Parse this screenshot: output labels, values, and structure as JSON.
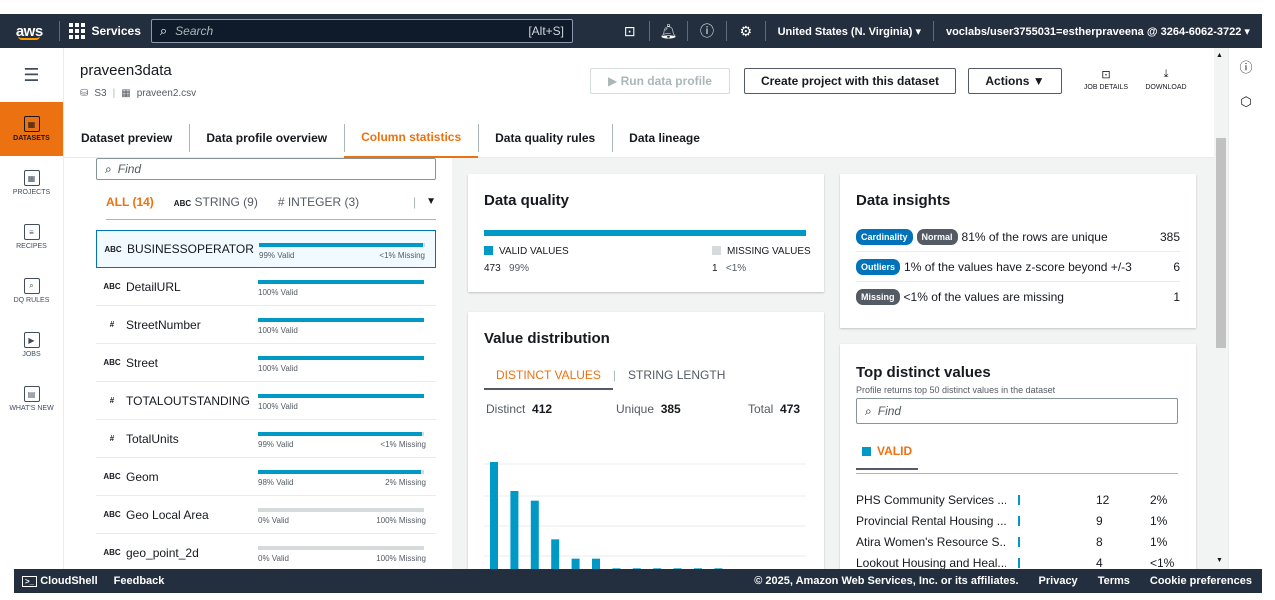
{
  "topbar": {
    "logo": "aws",
    "services": "Services",
    "search_placeholder": "Search",
    "search_shortcut": "[Alt+S]",
    "region": "United States (N. Virginia) ▾",
    "account": "voclabs/user3755031=estherpraveena @ 3264-6062-3722 ▾"
  },
  "leftnav": {
    "items": [
      {
        "label": "DATASETS",
        "icon": "grid-icon"
      },
      {
        "label": "PROJECTS",
        "icon": "projects-icon"
      },
      {
        "label": "RECIPES",
        "icon": "recipes-icon"
      },
      {
        "label": "DQ RULES",
        "icon": "dq-rules-icon"
      },
      {
        "label": "JOBS",
        "icon": "jobs-icon"
      },
      {
        "label": "WHAT'S NEW",
        "icon": "whats-new-icon"
      }
    ]
  },
  "header": {
    "dataset_name": "praveen3data",
    "source": "S3",
    "file": "praveen2.csv",
    "run_profile": "▶  Run data profile",
    "create_project": "Create project with this dataset",
    "actions": "Actions  ▼",
    "job_details": "JOB DETAILS",
    "download": "DOWNLOAD"
  },
  "tabs": [
    "Dataset preview",
    "Data profile overview",
    "Column statistics",
    "Data quality rules",
    "Data lineage"
  ],
  "columns_panel": {
    "find_placeholder": "Find",
    "filters": [
      "ALL (14)",
      "STRING (9)",
      "# INTEGER (3)"
    ],
    "filter_type_badge": "ABC",
    "columns": [
      {
        "type": "ABC",
        "name": "BUSINESSOPERATOR",
        "valid_pct": 99,
        "valid": "99% Valid",
        "missing": "<1% Missing"
      },
      {
        "type": "ABC",
        "name": "DetailURL",
        "valid_pct": 100,
        "valid": "100% Valid",
        "missing": ""
      },
      {
        "type": "#",
        "name": "StreetNumber",
        "valid_pct": 100,
        "valid": "100% Valid",
        "missing": ""
      },
      {
        "type": "ABC",
        "name": "Street",
        "valid_pct": 100,
        "valid": "100% Valid",
        "missing": ""
      },
      {
        "type": "#",
        "name": "TOTALOUTSTANDING",
        "valid_pct": 100,
        "valid": "100% Valid",
        "missing": ""
      },
      {
        "type": "#",
        "name": "TotalUnits",
        "valid_pct": 99,
        "valid": "99% Valid",
        "missing": "<1% Missing"
      },
      {
        "type": "ABC",
        "name": "Geom",
        "valid_pct": 98,
        "valid": "98% Valid",
        "missing": "2% Missing"
      },
      {
        "type": "ABC",
        "name": "Geo Local Area",
        "valid_pct": 0,
        "valid": "0% Valid",
        "missing": "100% Missing"
      },
      {
        "type": "ABC",
        "name": "geo_point_2d",
        "valid_pct": 0,
        "valid": "0% Valid",
        "missing": "100% Missing"
      }
    ]
  },
  "data_quality": {
    "title": "Data quality",
    "valid_label": "VALID VALUES",
    "valid_count": "473",
    "valid_pct": "99%",
    "missing_label": "MISSING VALUES",
    "missing_count": "1",
    "missing_pct": "<1%",
    "colors": {
      "valid": "#0099c6",
      "missing": "#d5dbdb"
    }
  },
  "value_distribution": {
    "title": "Value distribution",
    "tab_distinct": "DISTINCT VALUES",
    "tab_length": "STRING LENGTH",
    "distinct_label": "Distinct",
    "distinct": "412",
    "unique_label": "Unique",
    "unique": "385",
    "total_label": "Total",
    "total": "473",
    "bars": [
      12,
      9,
      8,
      4,
      2,
      2,
      1,
      1,
      1,
      1,
      1,
      1
    ]
  },
  "insights": {
    "title": "Data insights",
    "rows": [
      {
        "badges": [
          "Cardinality",
          "Normal"
        ],
        "text": "81% of the rows are unique",
        "count": "385"
      },
      {
        "badges": [
          "Outliers"
        ],
        "text": "1% of the values have z-score beyond +/-3",
        "count": "6"
      },
      {
        "badges": [
          "Missing"
        ],
        "text": "<1% of the values are missing",
        "count": "1"
      }
    ]
  },
  "top_distinct": {
    "title": "Top distinct values",
    "subtitle": "Profile returns top 50 distinct values in the dataset",
    "find_placeholder": "Find",
    "valid_tab": "VALID",
    "rows": [
      {
        "name": "PHS Community Services ...",
        "count": "12",
        "pct": "2%"
      },
      {
        "name": "Provincial Rental Housing ...",
        "count": "9",
        "pct": "1%"
      },
      {
        "name": "Atira Women's Resource S...",
        "count": "8",
        "pct": "1%"
      },
      {
        "name": "Lookout Housing and Heal...",
        "count": "4",
        "pct": "<1%"
      }
    ]
  },
  "footer": {
    "cloudshell": "CloudShell",
    "feedback": "Feedback",
    "copyright": "© 2025, Amazon Web Services, Inc. or its affiliates.",
    "privacy": "Privacy",
    "terms": "Terms",
    "cookies": "Cookie preferences"
  }
}
